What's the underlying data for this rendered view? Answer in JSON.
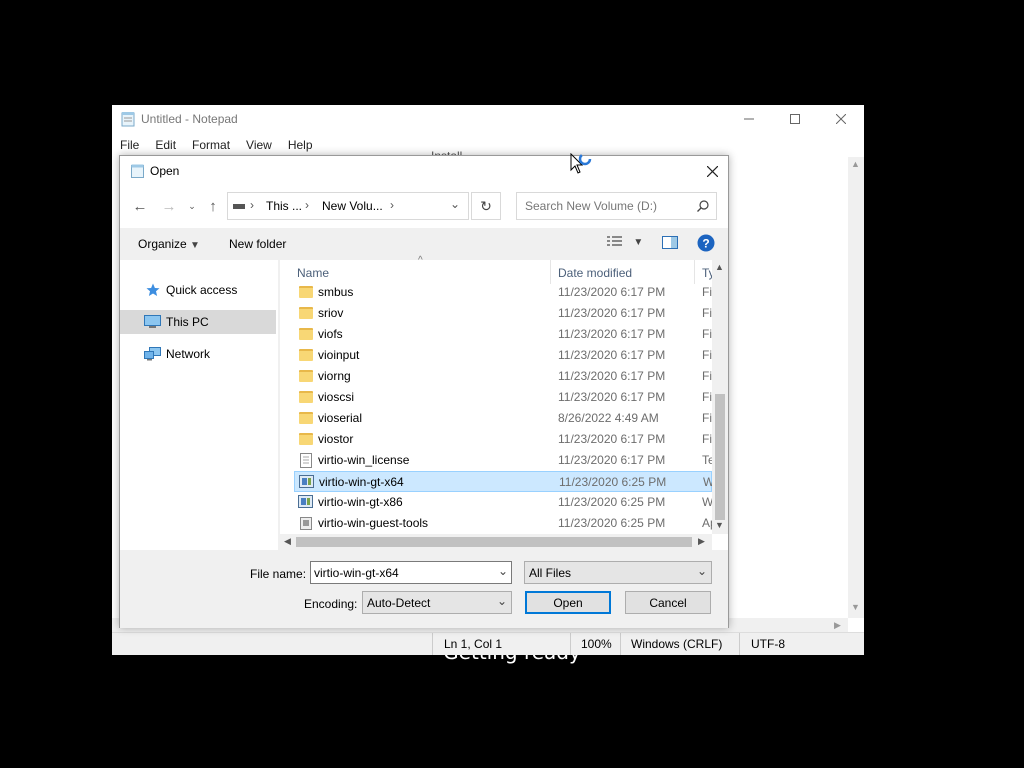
{
  "background_text": "Getting ready",
  "notepad": {
    "title": "Untitled - Notepad",
    "menu": [
      "File",
      "Edit",
      "Format",
      "View",
      "Help"
    ],
    "status": {
      "position": "Ln 1, Col 1",
      "zoom": "100%",
      "line_ending": "Windows (CRLF)",
      "encoding": "UTF-8"
    }
  },
  "install_window": {
    "title": "Install"
  },
  "dialog": {
    "title": "Open",
    "breadcrumb": [
      "This ...",
      "New Volu..."
    ],
    "search_placeholder": "Search New Volume (D:)",
    "toolbar": {
      "organize": "Organize",
      "new_folder": "New folder"
    },
    "nav": [
      "Quick access",
      "This PC",
      "Network"
    ],
    "columns": {
      "name": "Name",
      "date": "Date modified",
      "type": "Ty"
    },
    "files": [
      {
        "name": "smbus",
        "date": "11/23/2020 6:17 PM",
        "type": "Fi",
        "kind": "folder"
      },
      {
        "name": "sriov",
        "date": "11/23/2020 6:17 PM",
        "type": "Fi",
        "kind": "folder"
      },
      {
        "name": "viofs",
        "date": "11/23/2020 6:17 PM",
        "type": "Fi",
        "kind": "folder"
      },
      {
        "name": "vioinput",
        "date": "11/23/2020 6:17 PM",
        "type": "Fi",
        "kind": "folder"
      },
      {
        "name": "viorng",
        "date": "11/23/2020 6:17 PM",
        "type": "Fi",
        "kind": "folder"
      },
      {
        "name": "vioscsi",
        "date": "11/23/2020 6:17 PM",
        "type": "Fi",
        "kind": "folder"
      },
      {
        "name": "vioserial",
        "date": "8/26/2022 4:49 AM",
        "type": "Fi",
        "kind": "folder"
      },
      {
        "name": "viostor",
        "date": "11/23/2020 6:17 PM",
        "type": "Fi",
        "kind": "folder"
      },
      {
        "name": "virtio-win_license",
        "date": "11/23/2020 6:17 PM",
        "type": "Te",
        "kind": "text"
      },
      {
        "name": "virtio-win-gt-x64",
        "date": "11/23/2020 6:25 PM",
        "type": "W",
        "kind": "msi"
      },
      {
        "name": "virtio-win-gt-x86",
        "date": "11/23/2020 6:25 PM",
        "type": "W",
        "kind": "msi"
      },
      {
        "name": "virtio-win-guest-tools",
        "date": "11/23/2020 6:25 PM",
        "type": "Ap",
        "kind": "exe"
      }
    ],
    "file_name_label": "File name:",
    "file_name_value": "virtio-win-gt-x64",
    "filter": "All Files",
    "encoding_label": "Encoding:",
    "encoding_value": "Auto-Detect",
    "open_label": "Open",
    "cancel_label": "Cancel"
  }
}
